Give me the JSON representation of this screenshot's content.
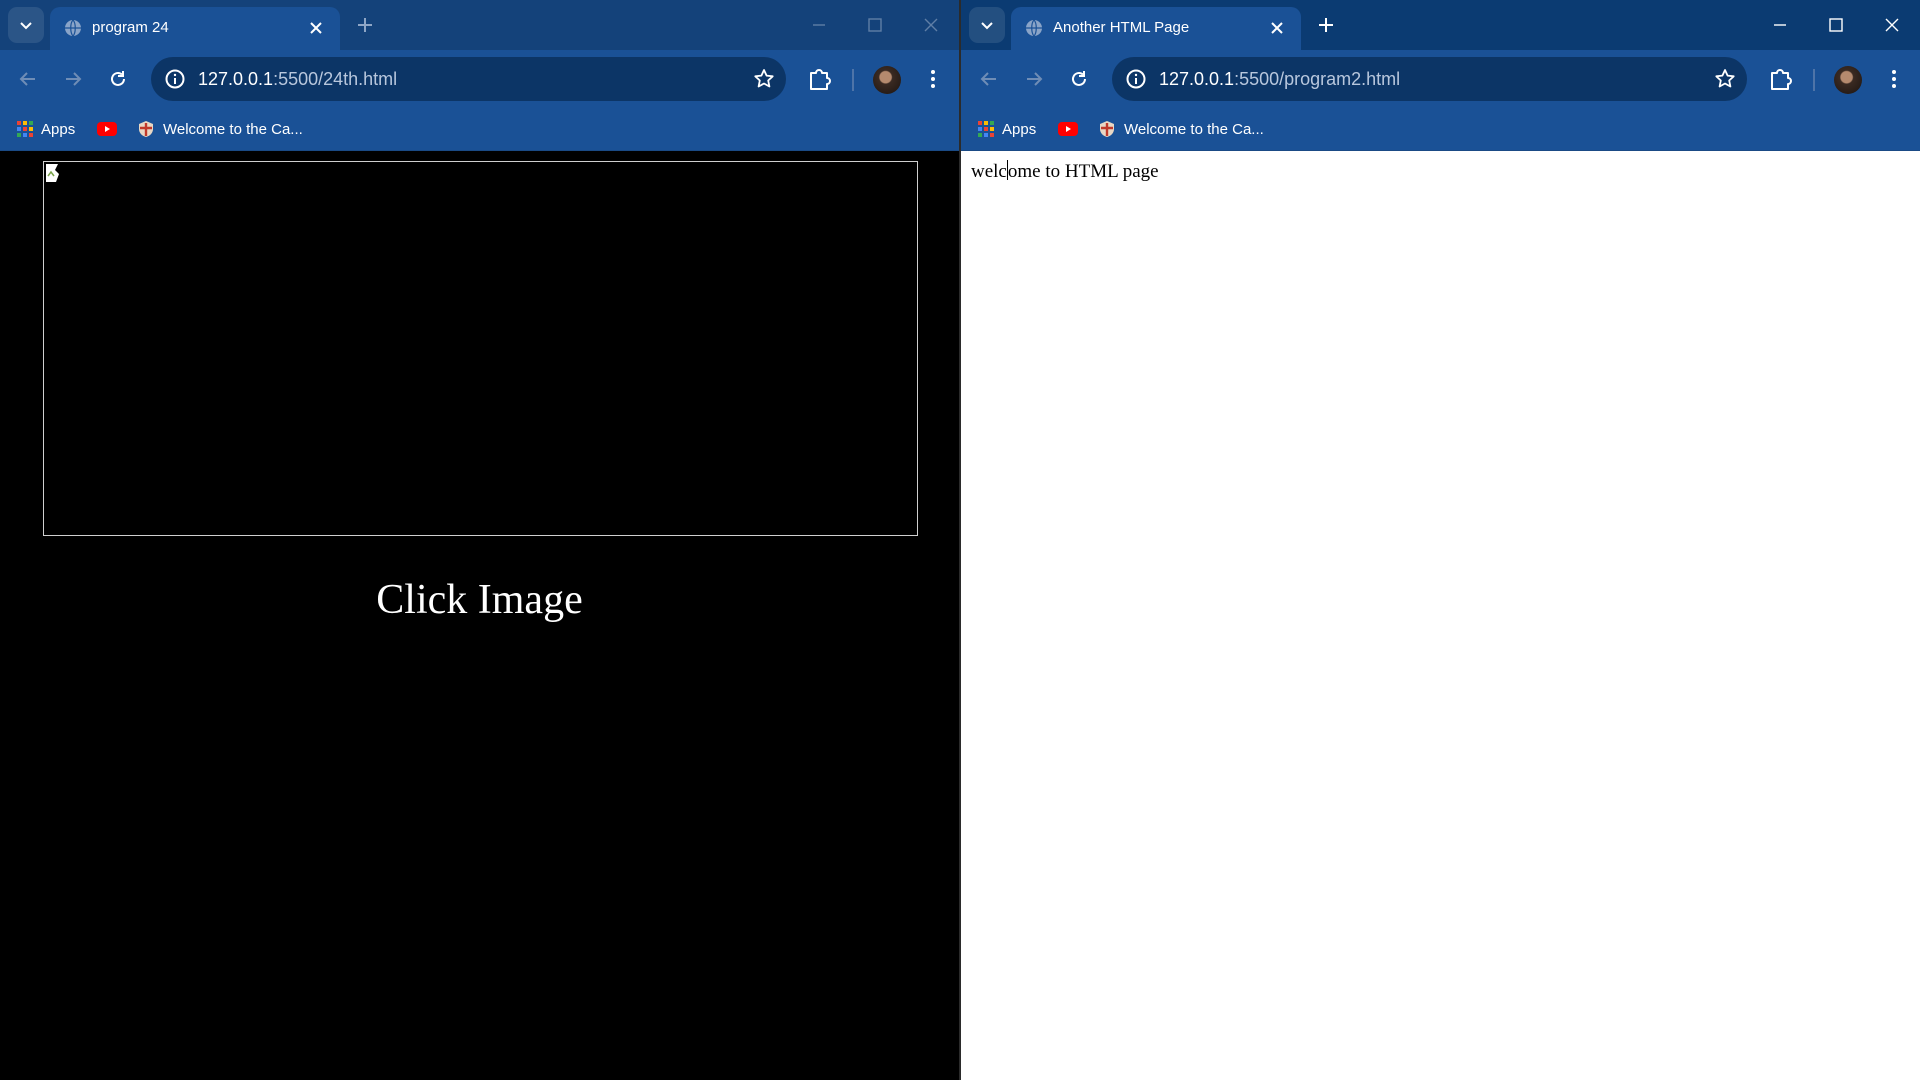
{
  "windows": [
    {
      "tab_title": "program 24",
      "url_host": "127.0.0.1",
      "url_path": ":5500/24th.html",
      "bookmarks": {
        "apps": "Apps",
        "welcome": "Welcome to the Ca..."
      },
      "page": {
        "caption": "Click Image"
      },
      "background": "#000000"
    },
    {
      "tab_title": "Another HTML Page",
      "url_host": "127.0.0.1",
      "url_path": ":5500/program2.html",
      "bookmarks": {
        "apps": "Apps",
        "welcome": "Welcome to the Ca..."
      },
      "page": {
        "text_before_caret": "welc",
        "text_after_caret": "ome to HTML page"
      },
      "background": "#ffffff"
    }
  ],
  "colors": {
    "tabstrip": "#0b3b72",
    "toolbar": "#1a5196",
    "omnibox": "#0c3566",
    "youtube_red": "#ff0000"
  },
  "icons": {
    "tab_search": "chevron-down-icon",
    "favicon": "globe-icon",
    "close": "close-icon",
    "new_tab": "plus-icon",
    "back": "arrow-left-icon",
    "forward": "arrow-right-icon",
    "reload": "reload-icon",
    "site_info": "info-icon",
    "bookmark": "star-icon",
    "extensions": "puzzle-icon",
    "menu": "kebab-menu-icon",
    "apps": "apps-grid-icon",
    "youtube": "youtube-icon",
    "broken_image": "broken-image-icon"
  }
}
